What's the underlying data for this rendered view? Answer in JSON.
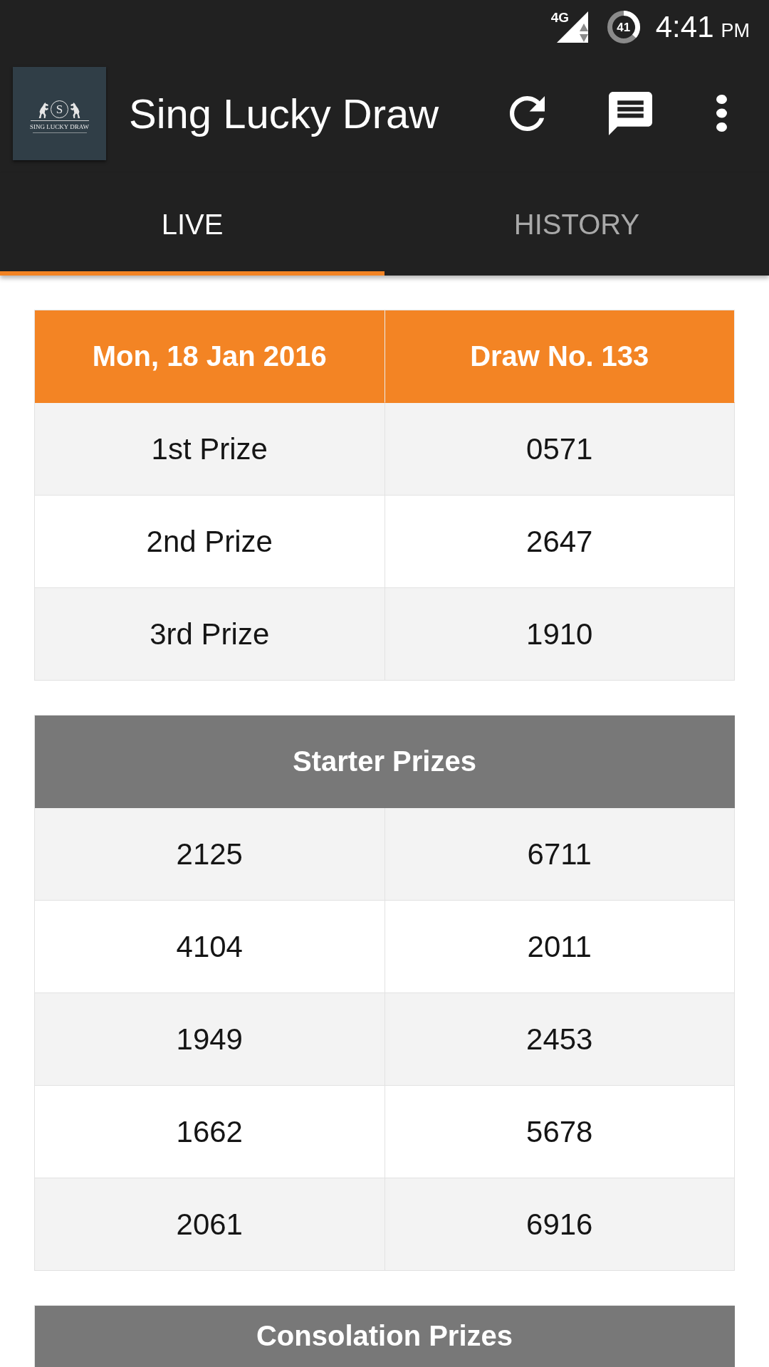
{
  "status_bar": {
    "network": "4G",
    "battery": "41",
    "time": "4:41",
    "period": "PM"
  },
  "app_bar": {
    "logo": {
      "monogram": "S",
      "wordmark": "SING LUCKY DRAW"
    },
    "title": "Sing Lucky Draw",
    "actions": [
      {
        "kind": "refresh"
      },
      {
        "kind": "message"
      },
      {
        "kind": "more"
      }
    ]
  },
  "tabs": [
    {
      "label": "LIVE",
      "selected": true
    },
    {
      "label": "HISTORY",
      "selected": false
    }
  ],
  "draw_result": {
    "date": "Mon, 18 Jan 2016",
    "draw_number": "Draw No. 133",
    "prizes": [
      {
        "label": "1st Prize",
        "number": "0571"
      },
      {
        "label": "2nd Prize",
        "number": "2647"
      },
      {
        "label": "3rd Prize",
        "number": "1910"
      }
    ]
  },
  "sections": [
    {
      "title": "Starter Prizes",
      "rows": [
        [
          "2125",
          "6711"
        ],
        [
          "4104",
          "2011"
        ],
        [
          "1949",
          "2453"
        ],
        [
          "1662",
          "5678"
        ],
        [
          "2061",
          "6916"
        ]
      ]
    },
    {
      "title": "Consolation Prizes"
    }
  ]
}
